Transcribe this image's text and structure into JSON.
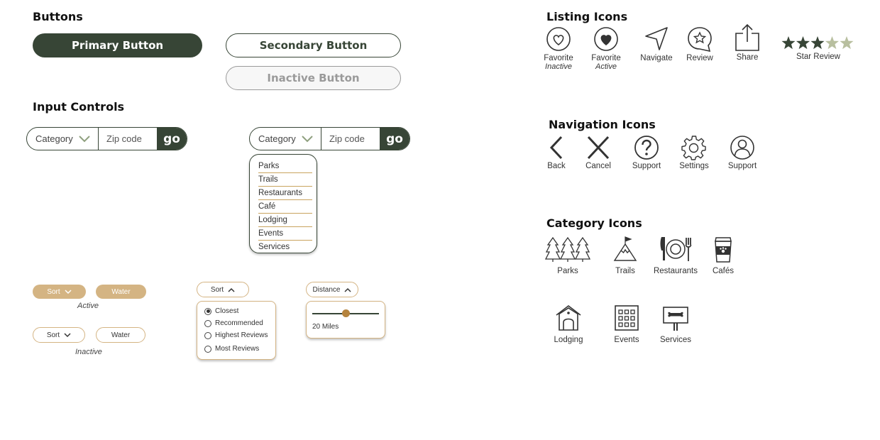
{
  "colors": {
    "accent_dark": "#374536",
    "accent_tan": "#d4b483",
    "star_light": "#b8bf9f"
  },
  "buttons": {
    "heading": "Buttons",
    "primary": "Primary Button",
    "secondary": "Secondary Button",
    "inactive": "Inactive Button"
  },
  "inputs": {
    "heading": "Input Controls",
    "category_label": "Category",
    "zip_placeholder": "Zip code",
    "go_label": "go",
    "dropdown_options": [
      "Parks",
      "Trails",
      "Restaurants",
      "Café",
      "Lodging",
      "Events",
      "Services"
    ]
  },
  "chips": {
    "sort": "Sort",
    "water": "Water",
    "active_caption": "Active",
    "inactive_caption": "Inactive",
    "distance": "Distance"
  },
  "sort_panel": {
    "options": [
      "Closest",
      "Recommended",
      "Highest Reviews",
      "Most Reviews"
    ],
    "selected_index": 0
  },
  "distance_panel": {
    "value_label": "20  Miles",
    "slider_fraction": 0.5
  },
  "listing_icons": {
    "heading": "Listing Icons",
    "favorite": "Favorite",
    "favorite_inactive": "Inactive",
    "favorite_active": "Active",
    "navigate": "Navigate",
    "review": "Review",
    "share": "Share",
    "star_review": "Star Review",
    "stars_filled": 3,
    "stars_total": 5
  },
  "navigation_icons": {
    "heading": "Navigation Icons",
    "back": "Back",
    "cancel": "Cancel",
    "support_question": "Support",
    "settings": "Settings",
    "support_person": "Support"
  },
  "category_icons": {
    "heading": "Category Icons",
    "parks": "Parks",
    "trails": "Trails",
    "restaurants": "Restaurants",
    "cafes": "Cafés",
    "lodging": "Lodging",
    "events": "Events",
    "services": "Services"
  }
}
